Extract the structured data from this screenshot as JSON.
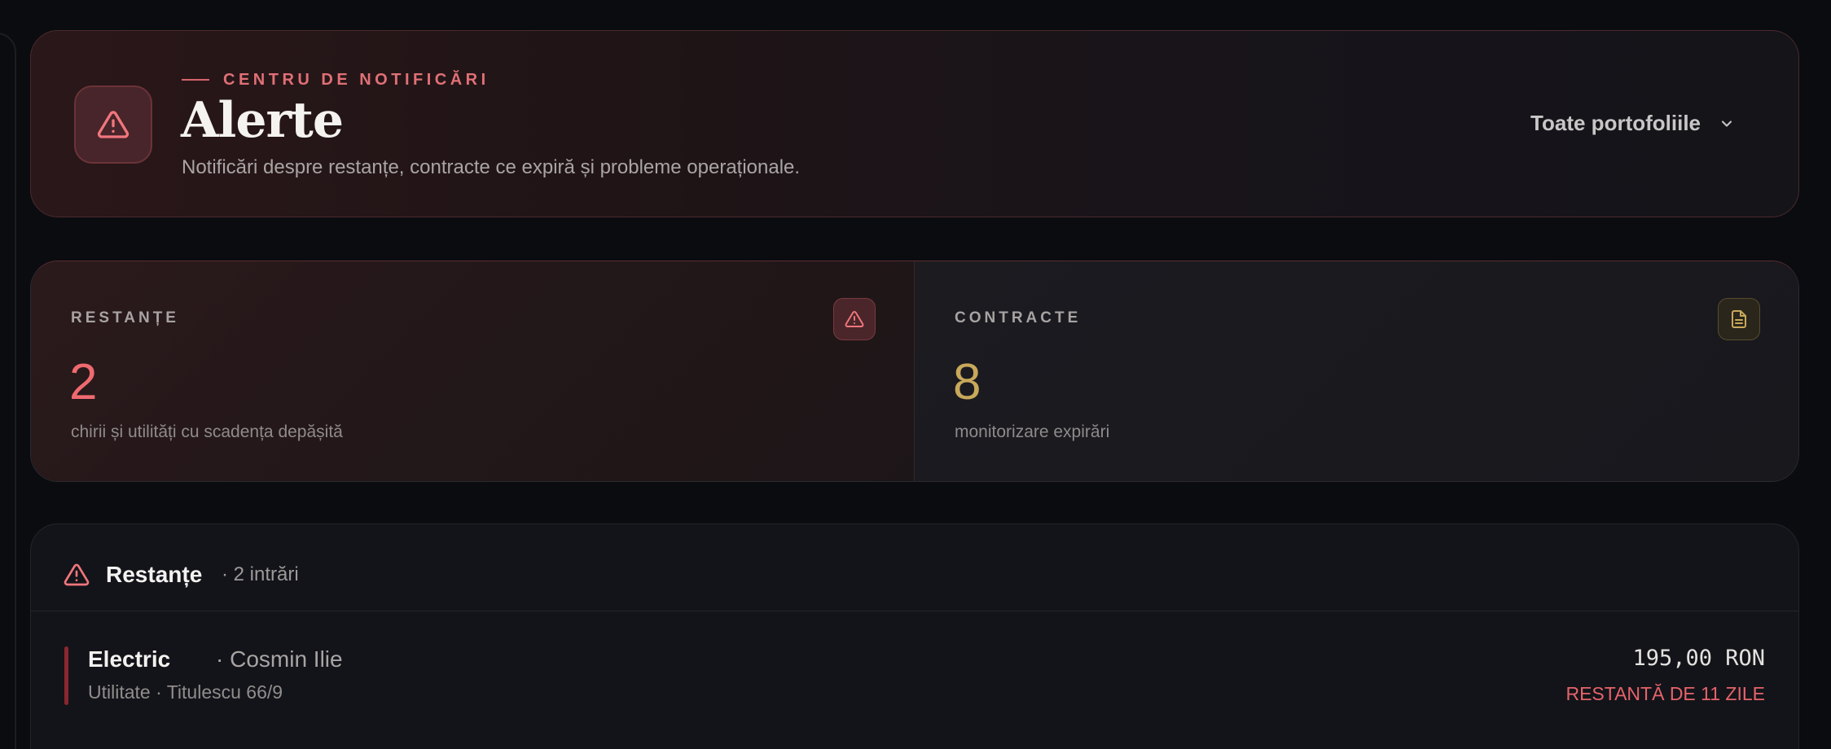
{
  "header": {
    "eyebrow": "CENTRU DE NOTIFICĂRI",
    "title": "Alerte",
    "subtitle": "Notificări despre restanțe, contracte ce expiră și probleme operaționale.",
    "icon": "alert-triangle-icon",
    "portfolio_select": {
      "value": "Toate portofoliile",
      "icon": "chevron-down-icon"
    }
  },
  "stats": {
    "restante": {
      "label": "RESTANȚE",
      "value": "2",
      "description": "chirii și utilități cu scadența depășită",
      "icon": "alert-triangle-icon",
      "color": "#ee6a6f"
    },
    "contracte": {
      "label": "CONTRACTE",
      "value": "8",
      "description": "monitorizare expirări",
      "icon": "document-icon",
      "color": "#c8a85a"
    }
  },
  "restante_list": {
    "title": "Restanțe",
    "count": "· 2 intrări",
    "icon": "alert-triangle-icon",
    "items": [
      {
        "name": "Electric",
        "tenant": "· Cosmin Ilie",
        "subtitle": "Utilitate · Titulescu 66/9",
        "amount": "195,00 RON",
        "status": "RESTANTĂ DE 11 ZILE"
      }
    ]
  },
  "colors": {
    "accent_red": "#e5636b",
    "accent_gold": "#c8a85a",
    "background": "#0b0c10"
  }
}
